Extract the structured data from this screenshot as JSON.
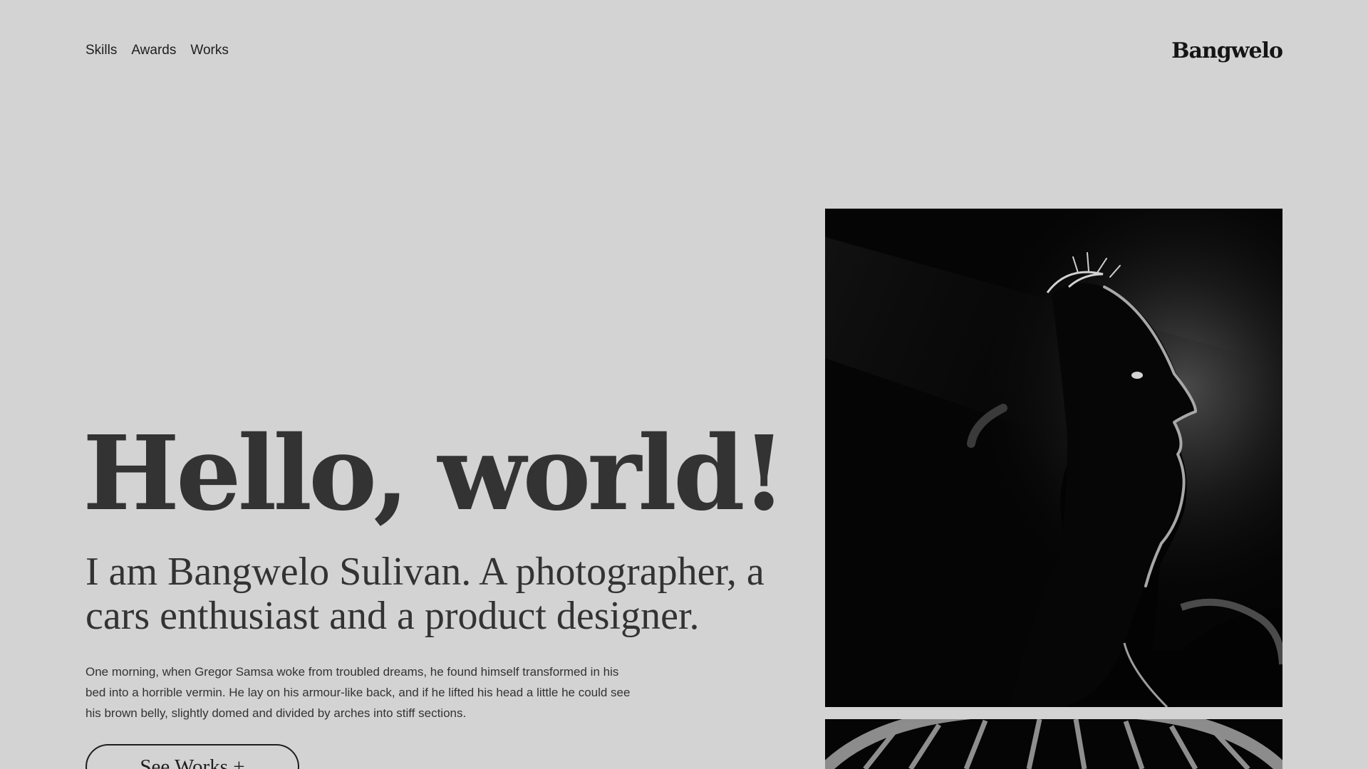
{
  "nav": {
    "items": [
      "Skills",
      "Awards",
      "Works"
    ]
  },
  "brand": "Bangwelo",
  "hero": {
    "title": "Hello, world!",
    "subtitle": "I am Bangwelo Sulivan. A photographer, a cars enthusiast and a product designer.",
    "body": "One morning, when Gregor Samsa woke from troubled dreams, he found himself transformed in his bed into a horrible vermin. He lay on his armour-like back, and if he lifted his head a little he could see his brown belly, slightly domed and divided by arches into stiff sections.",
    "cta": "See Works +"
  },
  "colors": {
    "background": "#d3d3d3",
    "text": "#333333",
    "brand": "#151515"
  }
}
